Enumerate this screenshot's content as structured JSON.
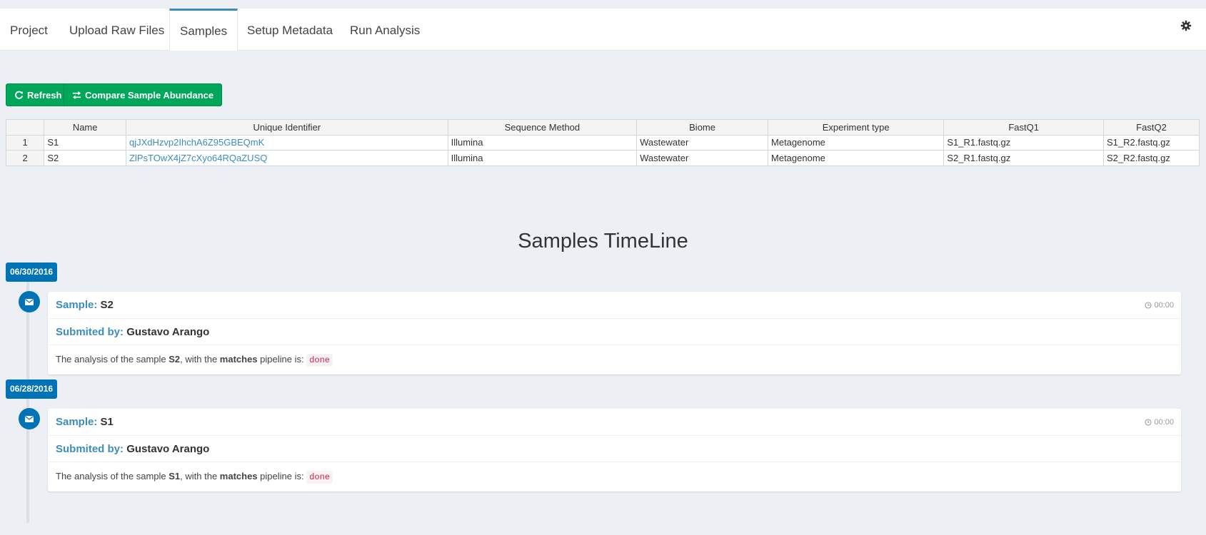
{
  "tabs": [
    {
      "label": "Project"
    },
    {
      "label": "Upload Raw Files"
    },
    {
      "label": "Samples"
    },
    {
      "label": "Setup Metadata"
    },
    {
      "label": "Run Analysis"
    }
  ],
  "active_tab": "Samples",
  "toolbar": {
    "refresh_label": "Refresh",
    "compare_label": "Compare Sample Abundance"
  },
  "table": {
    "headers": [
      "",
      "Name",
      "Unique Identifier",
      "Sequence Method",
      "Biome",
      "Experiment type",
      "FastQ1",
      "FastQ2"
    ],
    "rows": [
      {
        "num": "1",
        "name": "S1",
        "uid": "qjJXdHzvp2IhchA6Z95GBEQmK",
        "method": "Illumina",
        "biome": "Wastewater",
        "exp": "Metagenome",
        "fq1": "S1_R1.fastq.gz",
        "fq2": "S1_R2.fastq.gz"
      },
      {
        "num": "2",
        "name": "S2",
        "uid": "ZlPsTOwX4jZ7cXyo64RQaZUSQ",
        "method": "Illumina",
        "biome": "Wastewater",
        "exp": "Metagenome",
        "fq1": "S2_R1.fastq.gz",
        "fq2": "S2_R2.fastq.gz"
      }
    ]
  },
  "timeline": {
    "title": "Samples TimeLine",
    "entries": [
      {
        "date": "06/30/2016",
        "sample_label": "Sample:",
        "sample": "S2",
        "time": "00:00",
        "submitted_label": "Submited by:",
        "submitter": "Gustavo Arango",
        "text_a": "The analysis of the sample ",
        "text_sample": "S2",
        "text_b": ", with the ",
        "text_pipeline": "matches",
        "text_c": " pipeline is: ",
        "status": "done"
      },
      {
        "date": "06/28/2016",
        "sample_label": "Sample:",
        "sample": "S1",
        "time": "00:00",
        "submitted_label": "Submited by:",
        "submitter": "Gustavo Arango",
        "text_a": "The analysis of the sample ",
        "text_sample": "S1",
        "text_b": ", with the ",
        "text_pipeline": "matches",
        "text_c": " pipeline is: ",
        "status": "done"
      }
    ]
  },
  "colors": {
    "accent": "#3c8dbc",
    "success": "#00a65a",
    "timeline_blue": "#0073b7",
    "status_text": "#c7254e"
  },
  "icons": [
    "refresh-icon",
    "exchange-icon",
    "gear-icon",
    "envelope-icon",
    "clock-icon"
  ]
}
